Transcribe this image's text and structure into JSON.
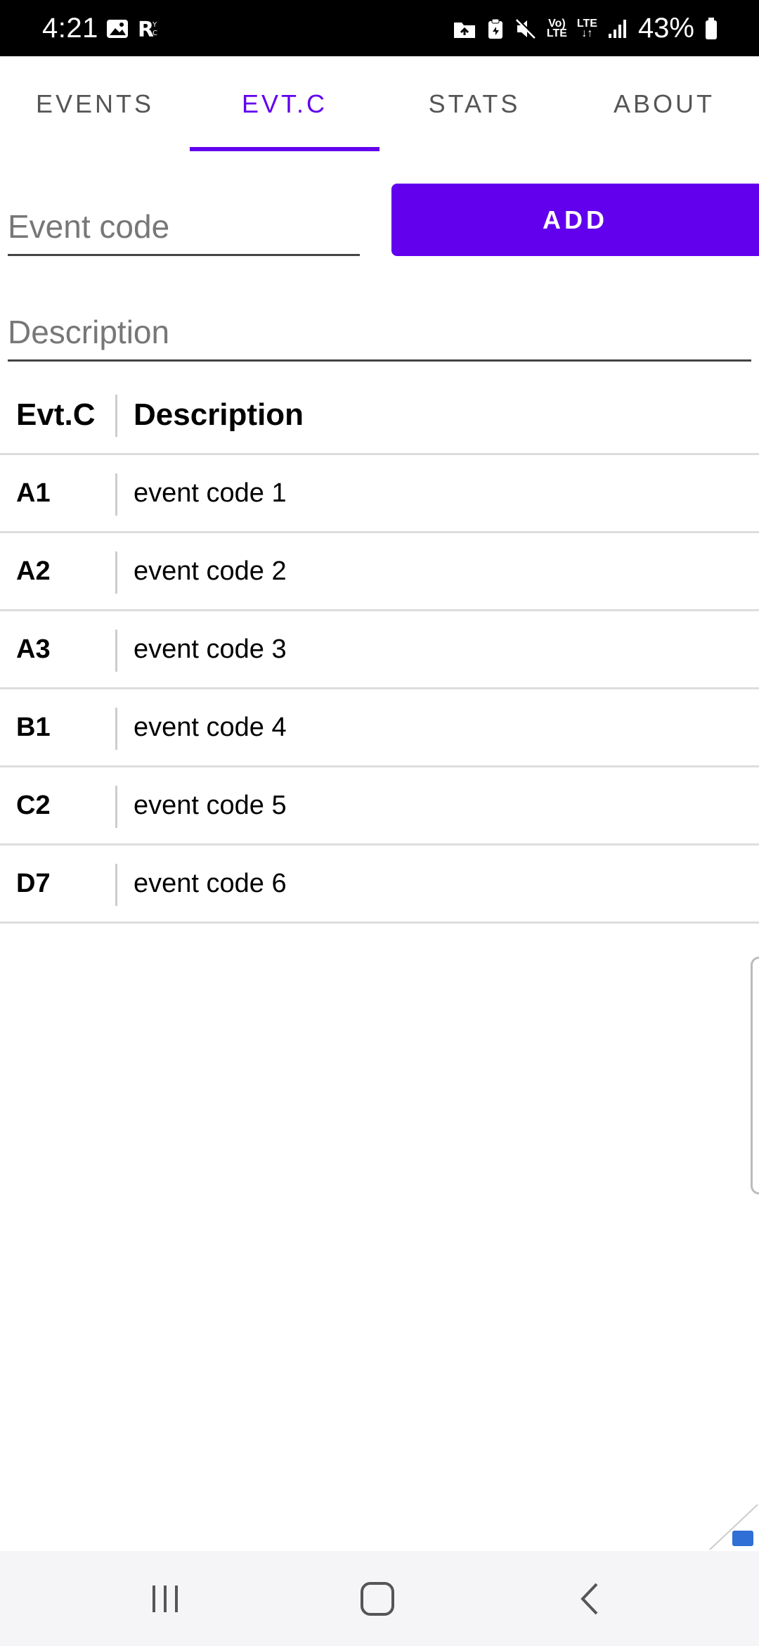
{
  "status_bar": {
    "time": "4:21",
    "battery_text": "43%",
    "network_label_top": "Vo)",
    "network_label_bottom": "LTE",
    "data_label": "LTE"
  },
  "tabs": [
    {
      "label": "EVENTS",
      "active": false
    },
    {
      "label": "EVT.C",
      "active": true
    },
    {
      "label": "STATS",
      "active": false
    },
    {
      "label": "ABOUT",
      "active": false
    }
  ],
  "form": {
    "event_code_placeholder": "Event code",
    "event_code_value": "",
    "description_placeholder": "Description",
    "description_value": "",
    "add_label": "ADD"
  },
  "table": {
    "headers": {
      "code": "Evt.C",
      "description": "Description"
    },
    "rows": [
      {
        "code": "A1",
        "description": "event code 1"
      },
      {
        "code": "A2",
        "description": "event code 2"
      },
      {
        "code": "A3",
        "description": "event code 3"
      },
      {
        "code": "B1",
        "description": "event code 4"
      },
      {
        "code": "C2",
        "description": "event code 5"
      },
      {
        "code": "D7",
        "description": "event code 6"
      }
    ]
  },
  "colors": {
    "accent": "#6200EE",
    "status_bar_bg": "#000000",
    "nav_bar_bg": "#f5f5f7"
  }
}
